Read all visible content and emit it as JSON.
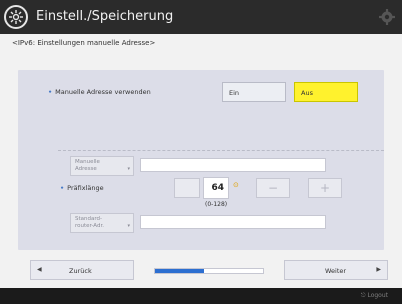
{
  "header": {
    "title": "Einstell./Speicherung",
    "app_icon": "settings-wheel-icon",
    "right_icon": "gear-icon"
  },
  "breadcrumb": "<IPv6: Einstellungen manuelle Adresse>",
  "manual_address": {
    "label": "Manuelle Adresse verwenden",
    "options": [
      {
        "label": "Ein",
        "selected": false
      },
      {
        "label": "Aus",
        "selected": true
      }
    ]
  },
  "fields": {
    "manual_address_button": {
      "line1": "Manuelle",
      "line2": "Adresse"
    },
    "prefix": {
      "label": "Präfixlänge",
      "value": "64",
      "range": "(0-128)"
    },
    "default_router_button": {
      "line1": "Standard-",
      "line2": "router-Adr."
    }
  },
  "nav": {
    "back_label": "Zurück",
    "next_label": "Weiter",
    "progress": 0.45
  },
  "footer": {
    "logout_label": "Logout"
  },
  "colors": {
    "accent_selected": "#fff22d",
    "progress_fill": "#2c6fd1",
    "bullet": "#4a7cc7"
  }
}
